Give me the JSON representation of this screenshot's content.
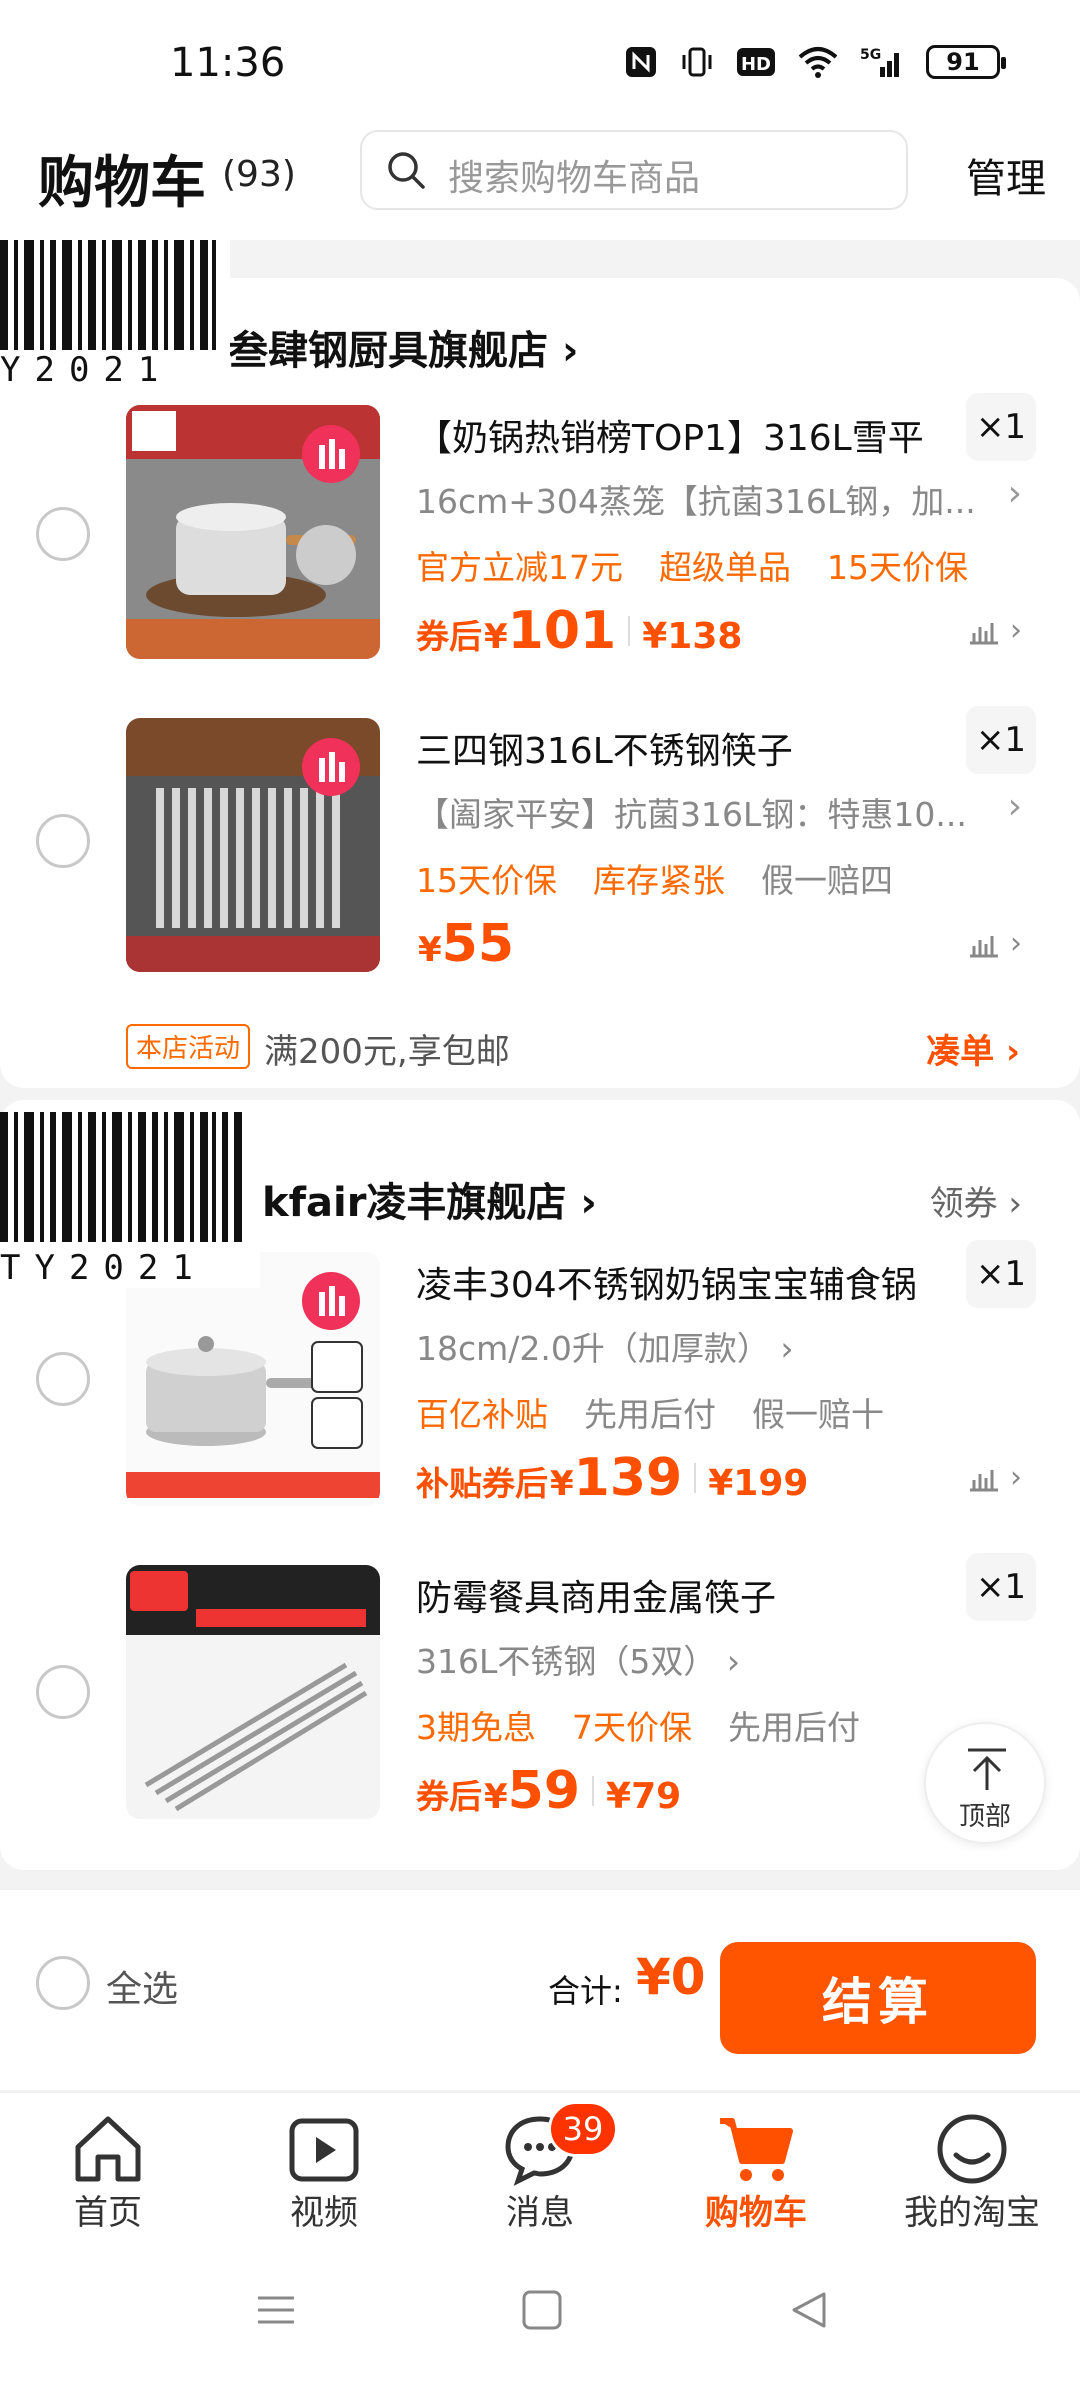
{
  "status": {
    "time": "11:36",
    "network": "5G",
    "hd": "HD",
    "battery": "91"
  },
  "header": {
    "title": "购物车",
    "count": "(93)",
    "search_placeholder": "搜索购物车商品",
    "manage": "管理"
  },
  "barcode": {
    "text": "Y2021",
    "text2": "TY2021"
  },
  "store1": {
    "name": "叁肆钢厨具旗舰店",
    "arrow": "›",
    "items": [
      {
        "title": "【奶锅热销榜TOP1】316L雪平",
        "qty": "×1",
        "sku": "16cm+304蒸笼【抗菌316L钢，加...",
        "tags": [
          "官方立减17元",
          "超级单品",
          "15天价保"
        ],
        "price_label": "券后",
        "yen": "¥",
        "price": "101",
        "orig": "¥138"
      },
      {
        "title": "三四钢316L不锈钢筷子",
        "qty": "×1",
        "sku": "【阖家平安】抗菌316L钢：特惠10...",
        "tags": [
          "15天价保",
          "库存紧张",
          "假一赔四"
        ],
        "price_label": "",
        "yen": "¥",
        "price": "55",
        "orig": ""
      }
    ],
    "activity": {
      "badge": "本店活动",
      "text": "满200元,享包邮",
      "link": "凑单 ›"
    }
  },
  "store2": {
    "name": "kfair凌丰旗舰店",
    "arrow": "›",
    "coupon": "领券 ›",
    "items": [
      {
        "title": "凌丰304不锈钢奶锅宝宝辅食锅",
        "qty": "×1",
        "sku": "18cm/2.0升（加厚款） ›",
        "tags": [
          "百亿补贴",
          "先用后付",
          "假一赔十"
        ],
        "price_label": "补贴券后",
        "yen": "¥",
        "price": "139",
        "orig": "¥199"
      },
      {
        "title": "防霉餐具商用金属筷子",
        "qty": "×1",
        "sku": "316L不锈钢（5双） ›",
        "tags": [
          "3期免息",
          "7天价保",
          "先用后付"
        ],
        "price_label": "券后",
        "yen": "¥",
        "price": "59",
        "orig": "¥79"
      }
    ]
  },
  "back_top": {
    "label": "顶部"
  },
  "checkout": {
    "select_all": "全选",
    "total_label": "合计:",
    "total_value": "¥0",
    "button": "结算"
  },
  "tabs": [
    {
      "label": "首页",
      "icon": "home-icon"
    },
    {
      "label": "视频",
      "icon": "video-icon"
    },
    {
      "label": "消息",
      "icon": "message-icon",
      "badge": "39"
    },
    {
      "label": "购物车",
      "icon": "cart-icon",
      "active": true
    },
    {
      "label": "我的淘宝",
      "icon": "profile-icon"
    }
  ],
  "colors": {
    "accent": "#ff5000",
    "tag_orange": "#ff6a00",
    "checkout": "#ff5500"
  }
}
